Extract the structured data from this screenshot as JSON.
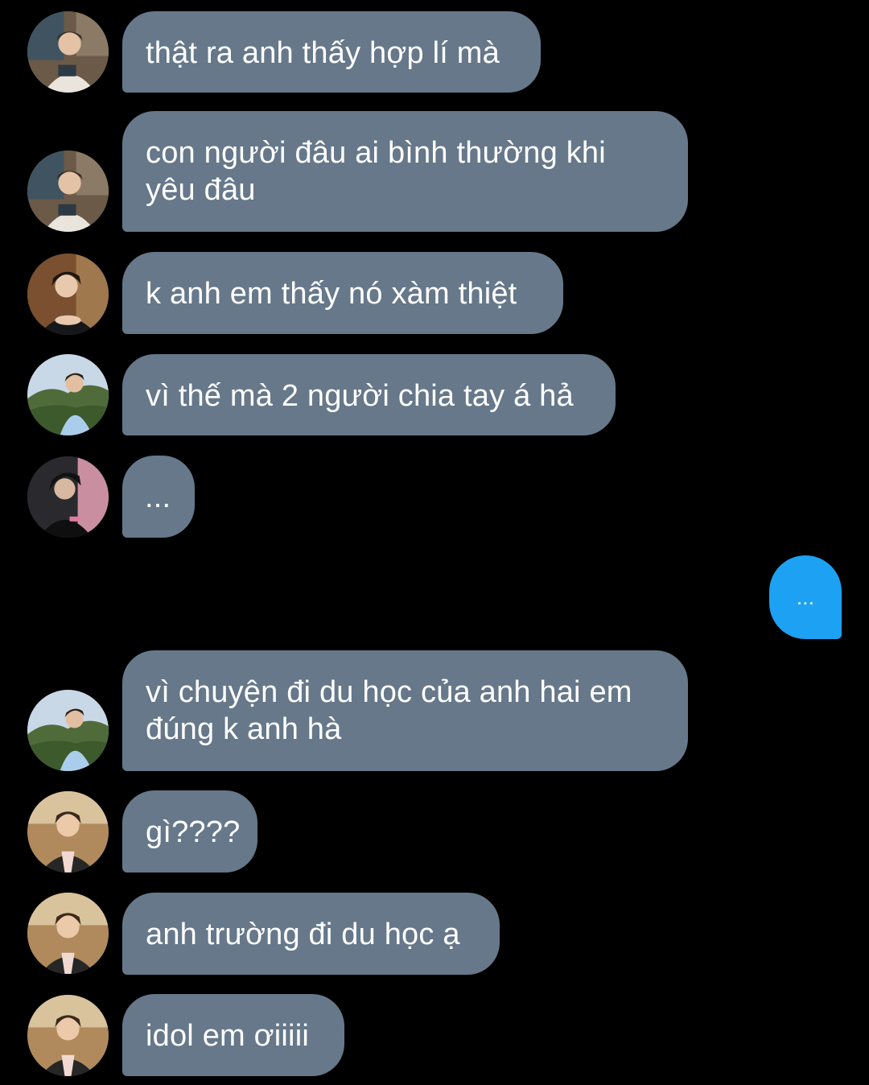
{
  "conversation": {
    "messages": [
      {
        "sender": "incoming",
        "avatar": "avatar-a",
        "text": "thật ra anh thấy hợp lí mà"
      },
      {
        "sender": "incoming",
        "avatar": "avatar-a",
        "text": "con người đâu ai bình thường khi\nyêu đâu"
      },
      {
        "sender": "incoming",
        "avatar": "avatar-b",
        "text": "k anh em thấy nó xàm thiệt"
      },
      {
        "sender": "incoming",
        "avatar": "avatar-c",
        "text": "vì thế mà 2 người chia tay á hả"
      },
      {
        "sender": "incoming",
        "avatar": "avatar-d",
        "text": "..."
      },
      {
        "sender": "outgoing",
        "text": "..."
      },
      {
        "sender": "incoming",
        "avatar": "avatar-c",
        "text": "vì chuyện đi du học của anh hai em\nđúng k anh hà"
      },
      {
        "sender": "incoming",
        "avatar": "avatar-e",
        "text": "gì????"
      },
      {
        "sender": "incoming",
        "avatar": "avatar-e",
        "text": "anh trường đi du học ạ"
      },
      {
        "sender": "incoming",
        "avatar": "avatar-e",
        "text": "idol em ơiiiii"
      }
    ]
  },
  "colors": {
    "background": "#000000",
    "incoming_bubble": "#66788a",
    "outgoing_bubble": "#1da1f2",
    "text": "#ffffff"
  }
}
